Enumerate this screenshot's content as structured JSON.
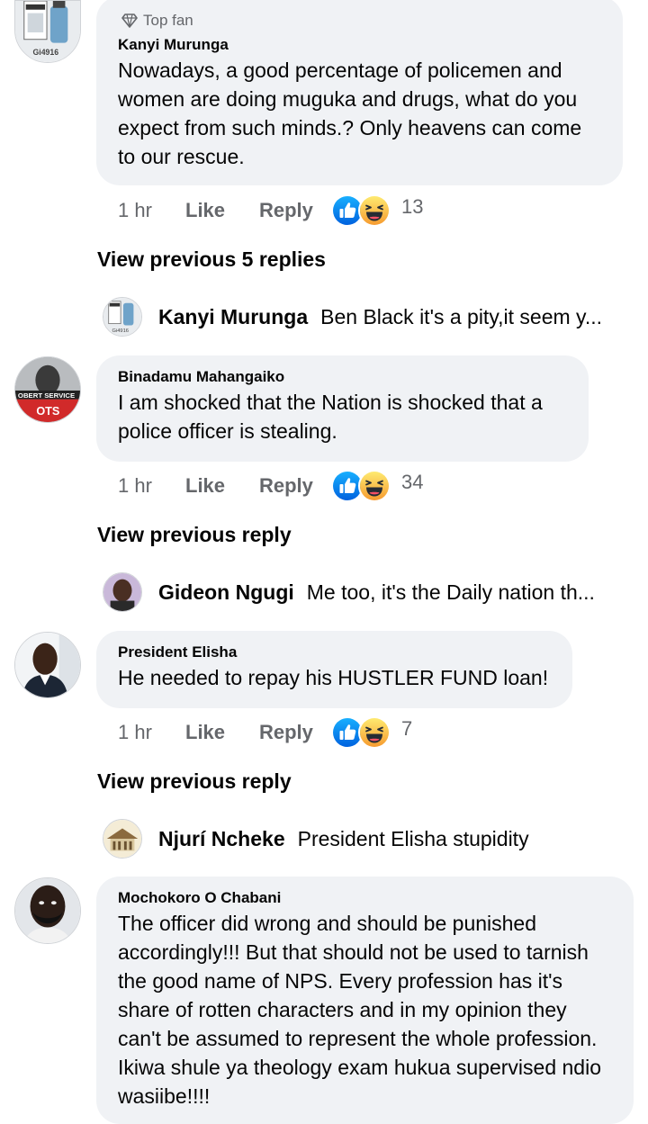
{
  "comments": [
    {
      "badge": "Top fan",
      "author": "Kanyi Murunga",
      "text": "Nowadays, a good percentage of  policemen and women are doing muguka and drugs, what do you expect from such minds.? Only heavens can come to our rescue.",
      "time": "1 hr",
      "like_label": "Like",
      "reply_label": "Reply",
      "reactions": [
        "like",
        "haha"
      ],
      "reaction_count": "13",
      "view_previous": "View previous 5 replies",
      "latest_reply": {
        "author": "Kanyi Murunga",
        "text": "Ben Black it's a pity,it seem y..."
      }
    },
    {
      "author": "Binadamu Mahangaiko",
      "text": "I am shocked that the Nation is shocked that a police officer is stealing.",
      "time": "1 hr",
      "like_label": "Like",
      "reply_label": "Reply",
      "reactions": [
        "like",
        "haha"
      ],
      "reaction_count": "34",
      "view_previous": "View previous reply",
      "latest_reply": {
        "author": "Gideon Ngugi",
        "text": "Me too, it's the Daily nation th..."
      }
    },
    {
      "author": "President Elisha",
      "text": "He needed to repay his HUSTLER FUND loan!",
      "time": "1 hr",
      "like_label": "Like",
      "reply_label": "Reply",
      "reactions": [
        "like",
        "haha"
      ],
      "reaction_count": "7",
      "view_previous": "View previous reply",
      "latest_reply": {
        "author": "Njurí Ncheke",
        "text": "President Elisha stupidity"
      }
    },
    {
      "author": "Mochokoro O Chabani",
      "text": "The officer did wrong and should be punished accordingly!!! But that should not be used to tarnish the good name of NPS. Every profession has it's share of rotten characters and in my opinion they can't be assumed to represent the whole profession. Ikiwa shule ya theology exam hukua supervised ndio wasiibe!!!!"
    }
  ],
  "colors": {
    "bubble": "#f0f2f5",
    "meta_text": "#65676b",
    "like_blue": "#1877f2",
    "haha_yellow": "#f7b125"
  }
}
